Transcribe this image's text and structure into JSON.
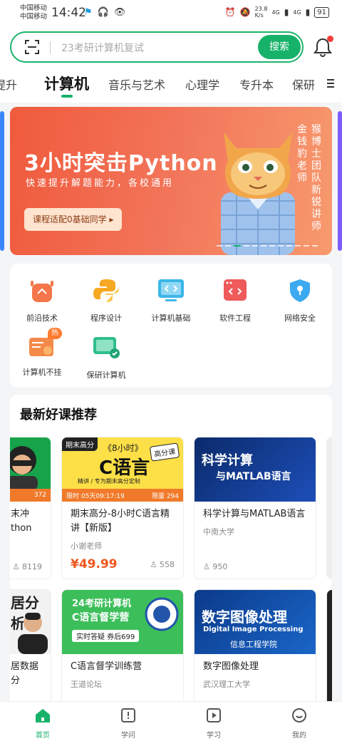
{
  "status": {
    "carrier1": "中国移动",
    "carrier2": "中国移动",
    "time": "14:42",
    "speed": "23.8\nK/s",
    "signal1": "4G",
    "signal2": "4G",
    "battery": "91"
  },
  "search": {
    "placeholder": "23考研计算机复试",
    "button": "搜索"
  },
  "tabs": [
    "提升",
    "计算机",
    "音乐与艺术",
    "心理学",
    "专升本",
    "保研"
  ],
  "banner": {
    "title": "3小时突击Python",
    "subtitle": "快速提升解题能力，各校通用",
    "pill": "课程适配0基础同学",
    "teacher": "金钱豹老师",
    "team": "猴博士团队新锐讲师"
  },
  "categories": [
    {
      "label": "前沿技术",
      "icon": "robot-icon"
    },
    {
      "label": "程序设计",
      "icon": "python-icon"
    },
    {
      "label": "计算机基础",
      "icon": "monitor-code-icon"
    },
    {
      "label": "软件工程",
      "icon": "code-window-icon"
    },
    {
      "label": "网络安全",
      "icon": "shield-icon"
    },
    {
      "label": "计算机不挂",
      "icon": "certificate-icon",
      "badge": "热"
    },
    {
      "label": "保研计算机",
      "icon": "screen-check-icon"
    }
  ],
  "section_title": "最新好课推荐",
  "courses_row1": [
    {
      "title_partial_1": "末冲",
      "title_partial_2": "thon",
      "count": "8119",
      "bar_count": "372"
    },
    {
      "title": "期末高分-8小时C语言精讲【新版】",
      "author": "小谢老师",
      "price": "¥49.99",
      "count": "558",
      "thumb_tag": "期末高分",
      "thumb_top": "《8小时》",
      "thumb_big": "C语言",
      "thumb_badge": "高分课",
      "thumb_sub": "精讲 / 专为期末高分定制",
      "limit_time": "限时 05天09:17:19",
      "limit_count": "限量 294"
    },
    {
      "title": "科学计算与MATLAB语言",
      "author": "中南大学",
      "count": "950",
      "thumb_big": "科学计算",
      "thumb_sub": "与MATLAB语言"
    }
  ],
  "courses_row2": [
    {
      "title_partial": "居数据分",
      "thumb_text": "居分析"
    },
    {
      "title": "C语言督学训练营",
      "author": "王道论坛",
      "thumb_top": "24考研计算机",
      "thumb_big": "C语言督学营",
      "thumb_sub": "实时答疑 券后699"
    },
    {
      "title": "数字图像处理",
      "author": "武汉理工大学",
      "thumb_big": "数字图像处理",
      "thumb_sub": "Digital Image Processing",
      "thumb_dept": "信息工程学院"
    }
  ],
  "nav": [
    {
      "label": "首页"
    },
    {
      "label": "学问"
    },
    {
      "label": "学习"
    },
    {
      "label": "我的"
    }
  ],
  "colors": {
    "accent": "#17b26a",
    "price": "#f0561c",
    "banner": "#f05a3c"
  }
}
